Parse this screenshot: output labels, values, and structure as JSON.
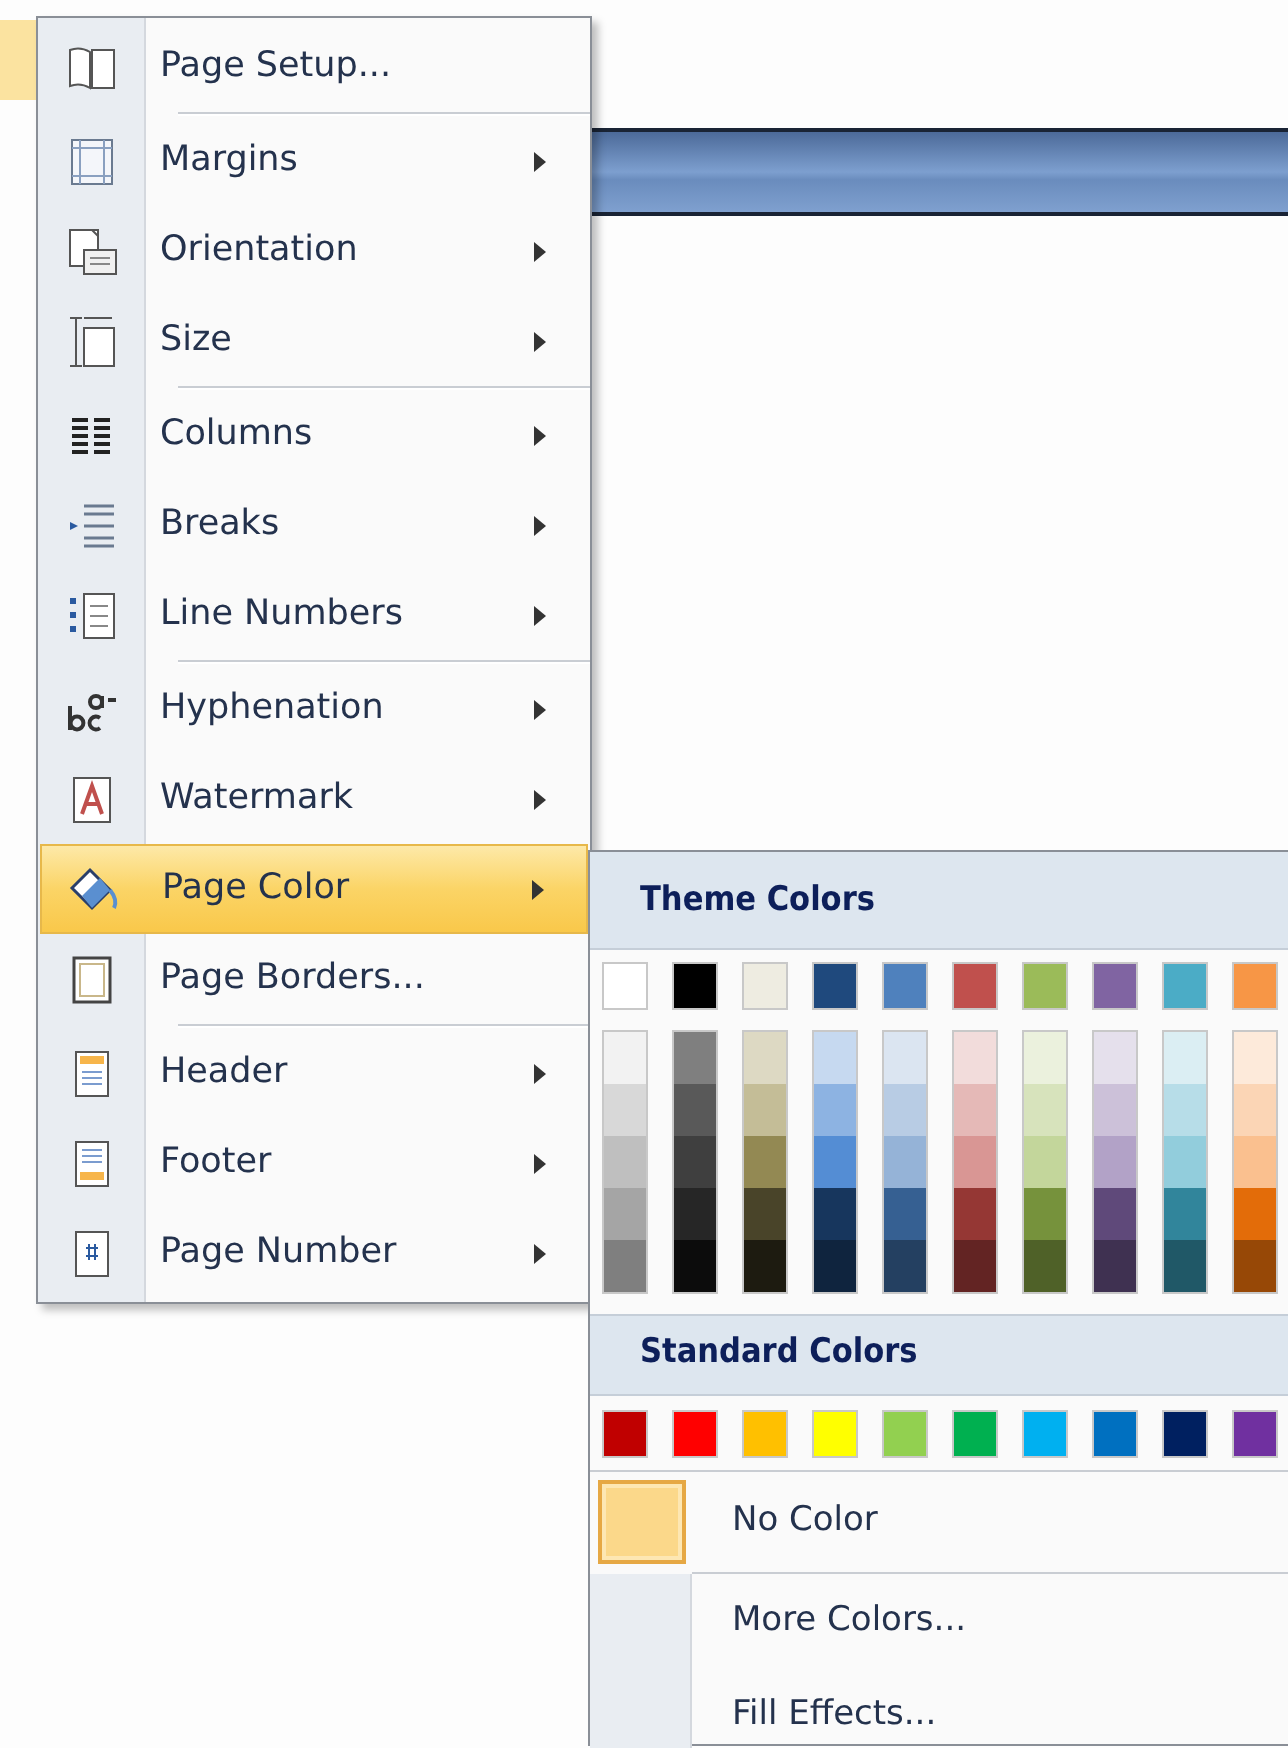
{
  "menu": {
    "groups": [
      [
        {
          "label": "Page Setup...",
          "kind": "command",
          "selected": false
        }
      ],
      [
        {
          "label": "Margins",
          "kind": "submenu",
          "selected": false
        },
        {
          "label": "Orientation",
          "kind": "submenu",
          "selected": false
        },
        {
          "label": "Size",
          "kind": "submenu",
          "selected": false
        }
      ],
      [
        {
          "label": "Columns",
          "kind": "submenu",
          "selected": false
        },
        {
          "label": "Breaks",
          "kind": "submenu",
          "selected": false
        },
        {
          "label": "Line Numbers",
          "kind": "submenu",
          "selected": false
        }
      ],
      [
        {
          "label": "Hyphenation",
          "kind": "submenu",
          "selected": false
        },
        {
          "label": "Watermark",
          "kind": "submenu",
          "selected": false
        },
        {
          "label": "Page Color",
          "kind": "submenu",
          "selected": true
        },
        {
          "label": "Page Borders...",
          "kind": "command",
          "selected": false
        }
      ],
      [
        {
          "label": "Header",
          "kind": "submenu",
          "selected": false
        },
        {
          "label": "Footer",
          "kind": "submenu",
          "selected": false
        },
        {
          "label": "Page Number",
          "kind": "submenu",
          "selected": false
        }
      ]
    ]
  },
  "page_color_menu": {
    "theme_heading": "Theme Colors",
    "theme_colors": [
      {
        "color": "#ffffff",
        "shades": [
          {
            "color": "#f2f2f2"
          },
          {
            "color": "#d8d8d8"
          },
          {
            "color": "#bfbfbf"
          },
          {
            "color": "#a5a5a5"
          },
          {
            "color": "#7f7f7f"
          }
        ]
      },
      {
        "color": "#000000",
        "shades": [
          {
            "color": "#7f7f7f"
          },
          {
            "color": "#595959"
          },
          {
            "color": "#3f3f3f"
          },
          {
            "color": "#262626"
          },
          {
            "color": "#0c0c0c"
          }
        ]
      },
      {
        "color": "#eeece1",
        "shades": [
          {
            "color": "#ddd9c3"
          },
          {
            "color": "#c4bd97"
          },
          {
            "color": "#938953"
          },
          {
            "color": "#494429"
          },
          {
            "color": "#1d1b10"
          }
        ]
      },
      {
        "color": "#1f497d",
        "shades": [
          {
            "color": "#c6d9f0"
          },
          {
            "color": "#8db3e2"
          },
          {
            "color": "#548dd4"
          },
          {
            "color": "#17365d"
          },
          {
            "color": "#0f243e"
          }
        ]
      },
      {
        "color": "#4f81bd",
        "shades": [
          {
            "color": "#dbe5f1"
          },
          {
            "color": "#b8cce4"
          },
          {
            "color": "#95b3d7"
          },
          {
            "color": "#366092"
          },
          {
            "color": "#244061"
          }
        ]
      },
      {
        "color": "#c0504d",
        "shades": [
          {
            "color": "#f2dcdb"
          },
          {
            "color": "#e5b9b7"
          },
          {
            "color": "#d99694"
          },
          {
            "color": "#953734"
          },
          {
            "color": "#632423"
          }
        ]
      },
      {
        "color": "#9bbb59",
        "shades": [
          {
            "color": "#ebf1dd"
          },
          {
            "color": "#d7e3bc"
          },
          {
            "color": "#c3d69b"
          },
          {
            "color": "#76923c"
          },
          {
            "color": "#4f6128"
          }
        ]
      },
      {
        "color": "#8064a2",
        "shades": [
          {
            "color": "#e5e0ec"
          },
          {
            "color": "#ccc1d9"
          },
          {
            "color": "#b2a2c7"
          },
          {
            "color": "#5f497a"
          },
          {
            "color": "#3f3151"
          }
        ]
      },
      {
        "color": "#4bacc6",
        "shades": [
          {
            "color": "#dbeef3"
          },
          {
            "color": "#b7dde8"
          },
          {
            "color": "#92cddc"
          },
          {
            "color": "#31859b"
          },
          {
            "color": "#205867"
          }
        ]
      },
      {
        "color": "#f79646",
        "shades": [
          {
            "color": "#fdeada"
          },
          {
            "color": "#fbd5b5"
          },
          {
            "color": "#fac08f"
          },
          {
            "color": "#e36c09"
          },
          {
            "color": "#974806"
          }
        ]
      }
    ],
    "standard_heading": "Standard Colors",
    "standard_colors": [
      {
        "color": "#c00000"
      },
      {
        "color": "#ff0000"
      },
      {
        "color": "#ffc000"
      },
      {
        "color": "#ffff00"
      },
      {
        "color": "#92d050"
      },
      {
        "color": "#00b050"
      },
      {
        "color": "#00b0f0"
      },
      {
        "color": "#0070c0"
      },
      {
        "color": "#002060"
      },
      {
        "color": "#7030a0"
      }
    ],
    "no_color": {
      "label": "No Color",
      "selected": true
    },
    "commands": [
      {
        "label": "More Colors..."
      },
      {
        "label": "Fill Effects..."
      }
    ]
  }
}
